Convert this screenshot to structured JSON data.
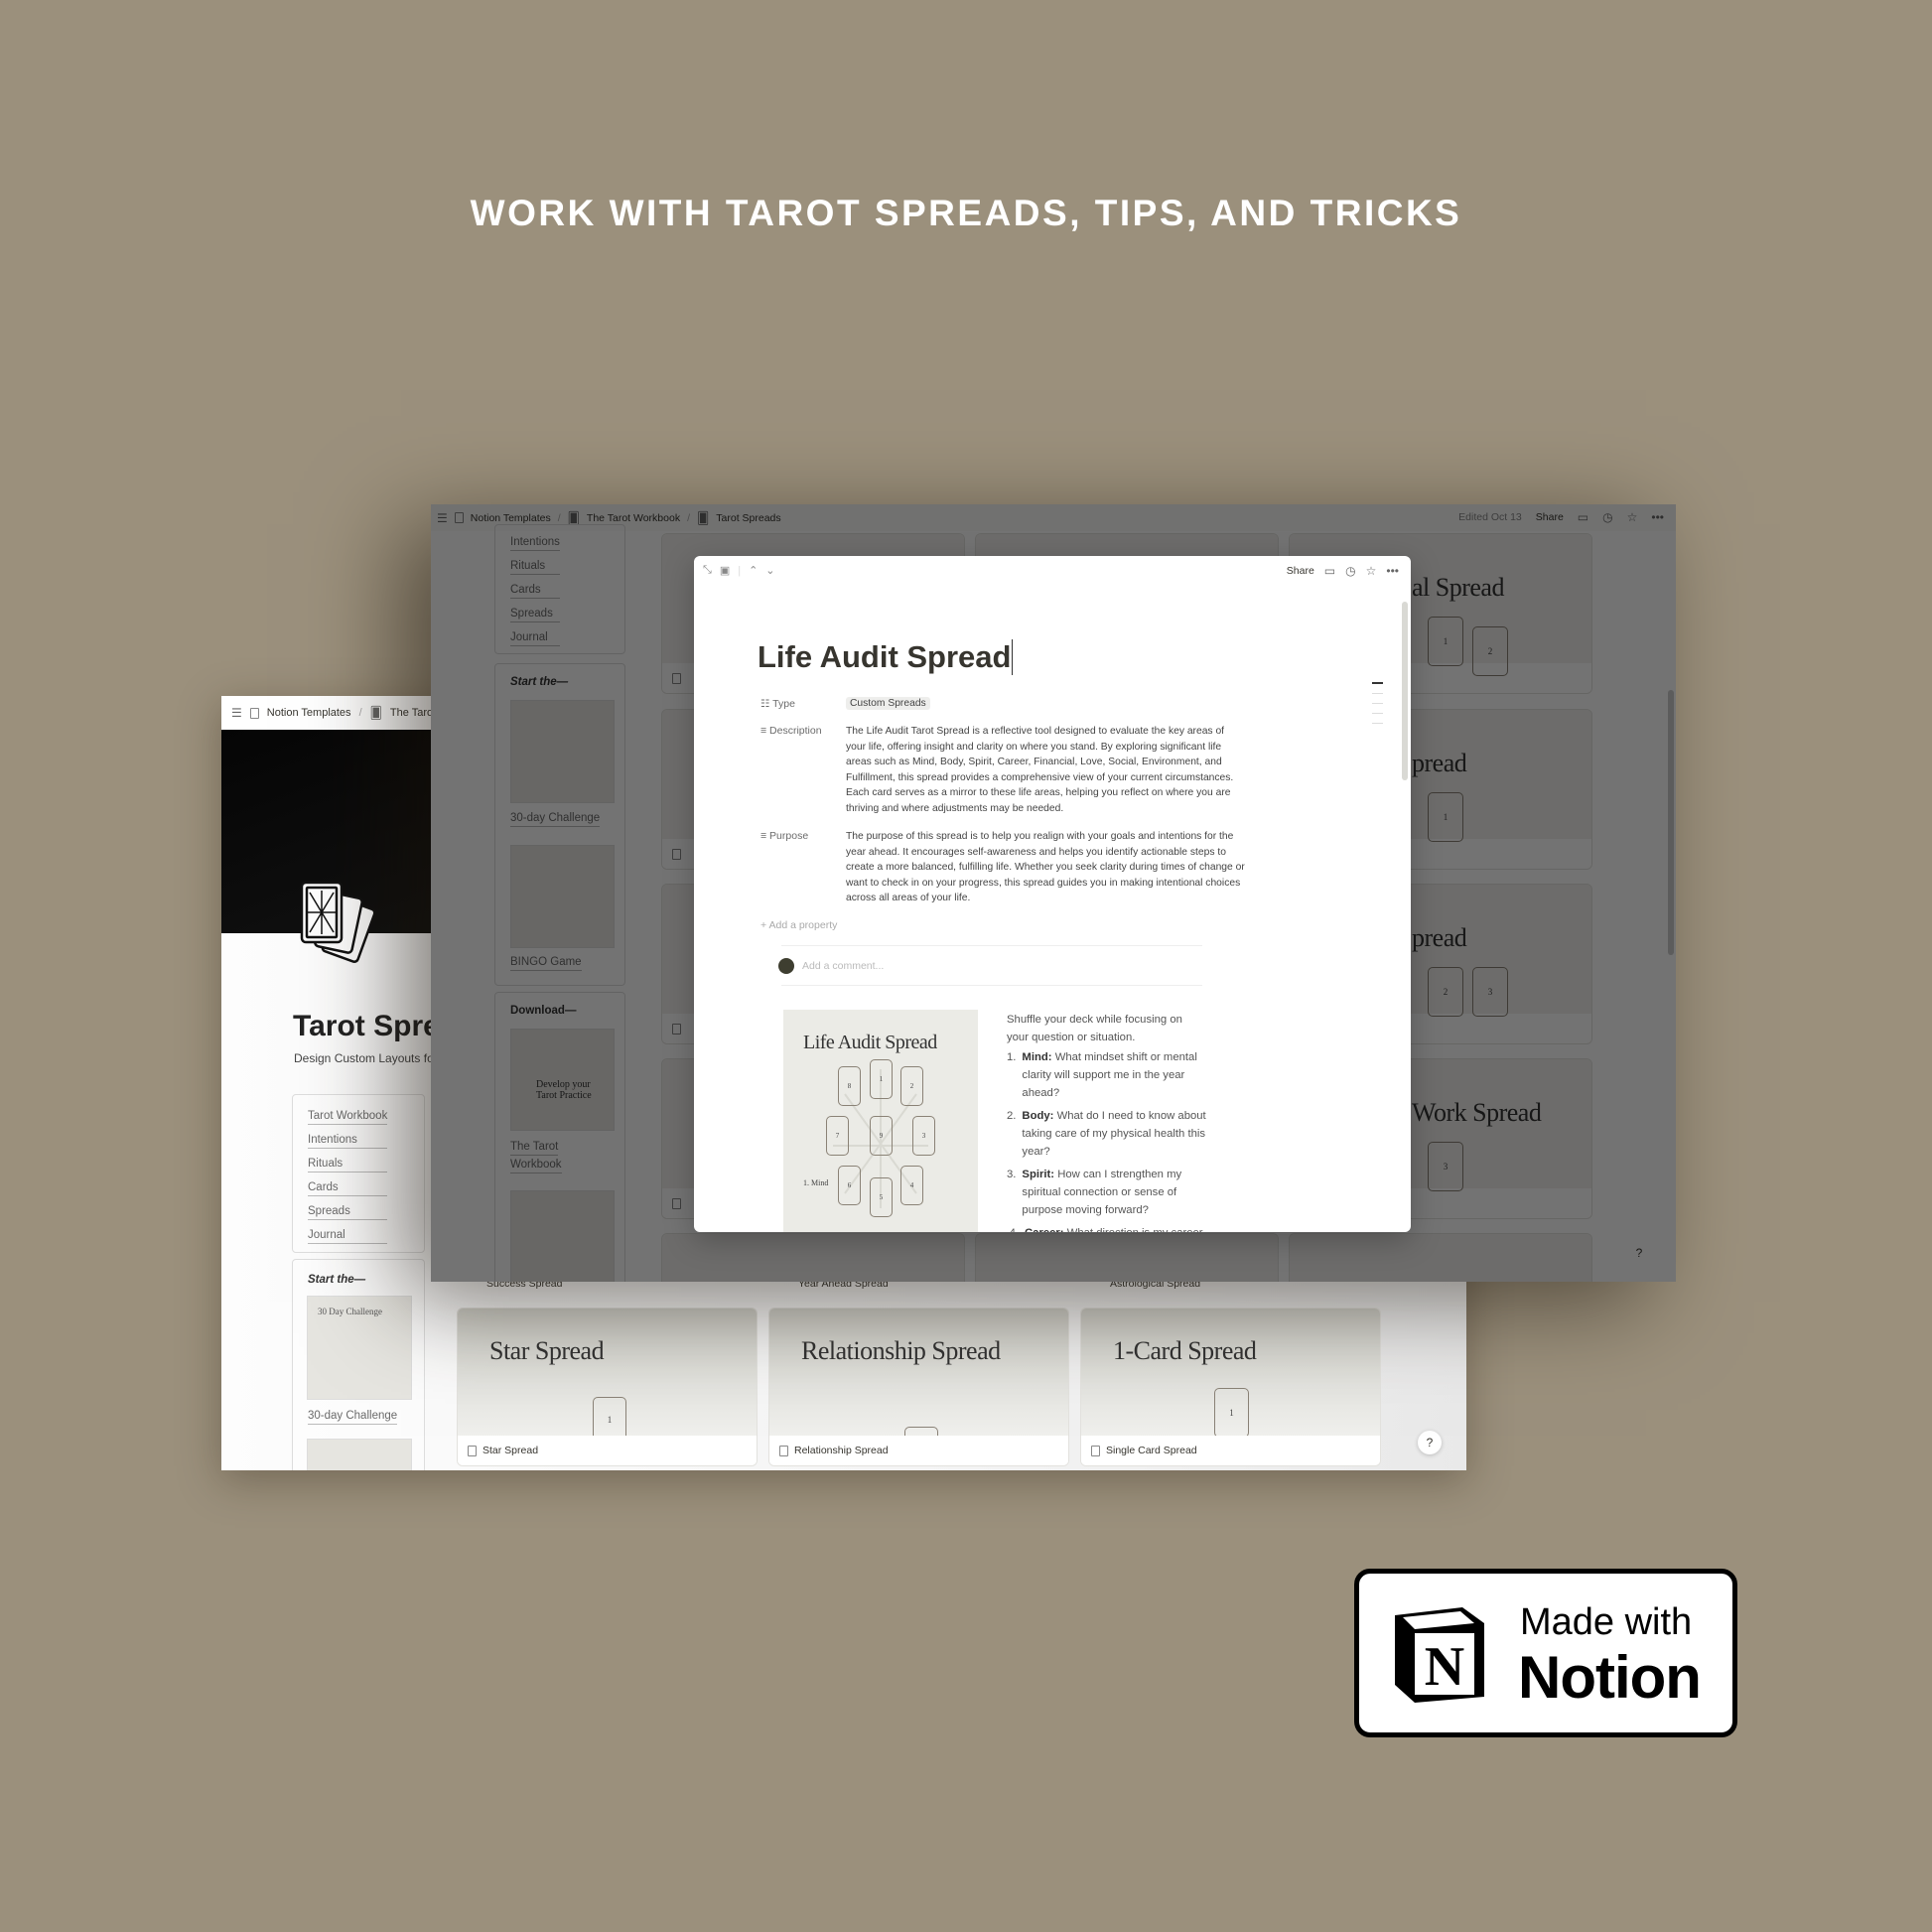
{
  "headline": "WORK WITH TAROT SPREADS, TIPS, AND TRICKS",
  "left_window": {
    "breadcrumb": [
      "Notion Templates",
      "The Tarot"
    ],
    "title": "Tarot Spre",
    "subtitle": "Design Custom Layouts for",
    "nav": [
      "Tarot Workbook",
      "Intentions",
      "Rituals",
      "Cards",
      "Spreads",
      "Journal"
    ],
    "start_label": "Start the—",
    "start_items": [
      "30-day Challenge"
    ],
    "thumb_text": "30 Day Challenge",
    "upper_labels": [
      "Success Spread",
      "Year Ahead Spread",
      "Astrological Spread"
    ],
    "cards": [
      {
        "title": "Star Spread",
        "label": "Star Spread",
        "cards": [
          "1"
        ]
      },
      {
        "title": "Relationship Spread",
        "label": "Relationship Spread",
        "cards": [
          ""
        ]
      },
      {
        "title": "1-Card Spread",
        "label": "Single Card Spread",
        "cards": [
          "1"
        ]
      }
    ]
  },
  "back_window": {
    "breadcrumb": [
      "Notion Templates",
      "The Tarot Workbook",
      "Tarot Spreads"
    ],
    "edited": "Edited Oct 13",
    "share": "Share",
    "nav": [
      "Intentions",
      "Rituals",
      "Cards",
      "Spreads",
      "Journal"
    ],
    "start_label": "Start the—",
    "start_items": [
      "30-day Challenge",
      "BINGO Game"
    ],
    "download_label": "Download—",
    "download_items": [
      "The Tarot",
      "Workbook"
    ],
    "download_thumb": "Develop your Tarot Practice",
    "gallery_fragments": [
      {
        "title": "al Spread",
        "cards": [
          "1",
          "2"
        ]
      },
      {
        "title": "pread",
        "cards": [
          "1"
        ]
      },
      {
        "title": "pread",
        "cards": [
          "2",
          "3"
        ]
      },
      {
        "title": "Work Spread",
        "cards": [
          "3"
        ]
      }
    ]
  },
  "modal": {
    "share": "Share",
    "title": "Life Audit Spread",
    "properties": [
      {
        "label": "Type",
        "value": "Custom Spreads"
      },
      {
        "label": "Description",
        "value": "The Life Audit Tarot Spread is a reflective tool designed to evaluate the key areas of your life, offering insight and clarity on where you stand. By exploring significant life areas such as Mind, Body, Spirit, Career, Financial, Love, Social, Environment, and Fulfillment, this spread provides a comprehensive view of your current circumstances. Each card serves as a mirror to these life areas, helping you reflect on where you are thriving and where adjustments may be needed."
      },
      {
        "label": "Purpose",
        "value": "The purpose of this spread is to help you realign with your goals and intentions for the year ahead. It encourages self-awareness and helps you identify actionable steps to create a more balanced, fulfilling life. Whether you seek clarity during times of change or want to check in on your progress, this spread guides you in making intentional choices across all areas of your life."
      }
    ],
    "add_property": "Add a property",
    "comment_placeholder": "Add a comment...",
    "image_title": "Life Audit Spread",
    "image_caption": "1. Mind",
    "card_numbers": [
      "1",
      "2",
      "3",
      "4",
      "5",
      "6",
      "7",
      "8",
      "9"
    ],
    "intro": "Shuffle your deck while focusing on your question or situation.",
    "list": [
      {
        "label": "Mind:",
        "text": "What mindset shift or mental clarity will support me in the year ahead?"
      },
      {
        "label": "Body:",
        "text": "What do I need to know about taking care of my physical health this year?"
      },
      {
        "label": "Spirit:",
        "text": "How can I strengthen my spiritual connection or sense of purpose moving forward?"
      },
      {
        "label": "Career:",
        "text": "What direction is my career"
      }
    ]
  },
  "badge": {
    "line1": "Made with",
    "line2": "Notion",
    "logo_letter": "N"
  },
  "colors": {
    "background": "#9b907c",
    "overlay": "rgba(0,0,0,0.55)",
    "card_bg": "#ebebe6"
  }
}
